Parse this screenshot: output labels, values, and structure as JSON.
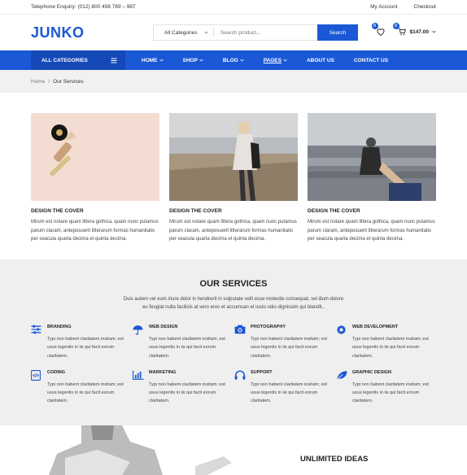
{
  "topbar": {
    "phone": "Telephone Enquiry: (012) 800 456 789 – 987",
    "account": "My Account",
    "checkout": "Checkout"
  },
  "header": {
    "logo": "JUNKO",
    "category_select": "All Categories",
    "search_placeholder": "Search product...",
    "search_button": "Search",
    "wishlist_count": "0",
    "cart_count": "0",
    "cart_total": "$147.00"
  },
  "nav": {
    "all_categories": "ALL CATEGORIES",
    "items": [
      "HOME",
      "SHOP",
      "BLOG",
      "PAGES",
      "ABOUT US",
      "CONTACT US"
    ]
  },
  "breadcrumb": {
    "home": "Home",
    "separator": "/",
    "current": "Our Services"
  },
  "posts": [
    {
      "title": "DESIGN THE COVER",
      "text": "Mirum est notare quam littera gothica, quam nunc putamus parum claram, anteposuerit litterarum formas humanitatis per seacula quarta decima et quinta decima."
    },
    {
      "title": "DESIGN THE COVER",
      "text": "Mirum est notare quam littera gothica, quam nunc putamus parum claram, anteposuerit litterarum formas humanitatis per seacula quarta decima et quinta decima."
    },
    {
      "title": "DESIGN THE COVER",
      "text": "Mirum est notare quam littera gothica, quam nunc putamus parum claram, anteposuerit litterarum formas humanitatis per seacula quarta decima et quinta decima."
    }
  ],
  "services": {
    "title": "OUR SERVICES",
    "intro_line1": "Duis autem vel eum iriure dolor in hendrerit in vulputate velit esse molestie consequat, vel illum dolore",
    "intro_line2": "eu feugiat nulla facilisis at vero eros et accumsan et iusto odio dignissim qui blandit..",
    "items": [
      {
        "title": "BRANDING",
        "text": "Typi non habent claritatem insitam; est usus legentis in iis qui facit eorum claritatem.",
        "icon": "sliders-icon"
      },
      {
        "title": "WEB DESIGN",
        "text": "Typi non habent claritatem insitam; est usus legentis in iis qui facit eorum claritatem.",
        "icon": "umbrella-icon"
      },
      {
        "title": "PHOTOGRAPHY",
        "text": "Typi non habent claritatem insitam; est usus legentis in iis qui facit eorum claritatem.",
        "icon": "camera-icon"
      },
      {
        "title": "WEB DEVELOPMENT",
        "text": "Typi non habent claritatem insitam; est usus legentis in iis qui facit eorum claritatem.",
        "icon": "gear-icon"
      },
      {
        "title": "CODING",
        "text": "Typi non habent claritatem insitam; est usus legentis in iis qui facit eorum claritatem.",
        "icon": "code-file-icon"
      },
      {
        "title": "MARKETING",
        "text": "Typi non habent claritatem insitam; est usus legentis in iis qui facit eorum claritatem.",
        "icon": "bar-chart-icon"
      },
      {
        "title": "SUPPORT",
        "text": "Typi non habent claritatem insitam; est usus legentis in iis qui facit eorum claritatem.",
        "icon": "headset-icon"
      },
      {
        "title": "GRAPHIC DESIGN",
        "text": "Typi non habent claritatem insitam; est usus legentis in iis qui facit eorum claritatem.",
        "icon": "leaf-icon"
      }
    ]
  },
  "bottom": {
    "heading": "UNLIMITED IDEAS"
  },
  "colors": {
    "brand": "#1a58d6",
    "brand_dark": "#1549b8",
    "services_bg": "#efefef"
  }
}
